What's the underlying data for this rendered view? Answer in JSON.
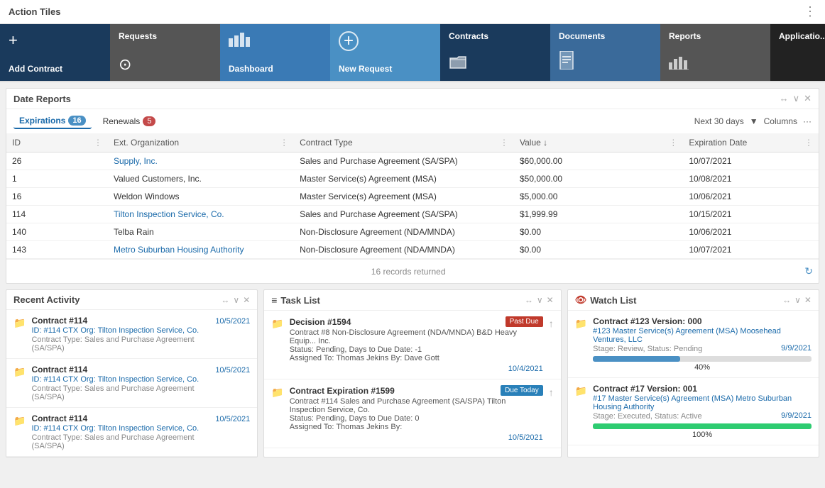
{
  "header": {
    "title": "Action Tiles",
    "menu_icon": "⋮"
  },
  "tiles": [
    {
      "id": "add-contract",
      "label": "Add Contract",
      "icon": "+",
      "style": "tile-blue-dark"
    },
    {
      "id": "requests",
      "label": "Requests",
      "icon": "⊙",
      "style": "tile-gray"
    },
    {
      "id": "dashboard",
      "label": "Dashboard",
      "icon": "📊",
      "style": "tile-blue-mid"
    },
    {
      "id": "new-request",
      "label": "New Request",
      "icon": "+",
      "style": "tile-blue-light"
    },
    {
      "id": "contracts",
      "label": "Contracts",
      "icon": "📁",
      "style": "tile-navy"
    },
    {
      "id": "documents",
      "label": "Documents",
      "icon": "📄",
      "style": "tile-steel"
    },
    {
      "id": "reports",
      "label": "Reports",
      "icon": "📊",
      "style": "tile-dark"
    },
    {
      "id": "applications",
      "label": "Applicatio...",
      "icon": "⬛",
      "style": "tile-black"
    }
  ],
  "date_reports": {
    "section_title": "Date Reports",
    "tabs": [
      {
        "label": "Expirations",
        "badge": "16",
        "active": true
      },
      {
        "label": "Renewals",
        "badge": "5",
        "active": false
      }
    ],
    "filter_label": "Next 30 days",
    "columns_label": "Columns",
    "table_headers": [
      "ID",
      "Ext. Organization",
      "Contract Type",
      "Value ↓",
      "Expiration Date"
    ],
    "table_rows": [
      {
        "id": "26",
        "org": "Supply, Inc.",
        "org_link": true,
        "type": "Sales and Purchase Agreement (SA/SPA)",
        "value": "$60,000.00",
        "expiration": "10/07/2021"
      },
      {
        "id": "1",
        "org": "Valued Customers, Inc.",
        "org_link": false,
        "type": "Master Service(s) Agreement (MSA)",
        "value": "$50,000.00",
        "expiration": "10/08/2021"
      },
      {
        "id": "16",
        "org": "Weldon Windows",
        "org_link": false,
        "type": "Master Service(s) Agreement (MSA)",
        "value": "$5,000.00",
        "expiration": "10/06/2021"
      },
      {
        "id": "114",
        "org": "Tilton Inspection Service, Co.",
        "org_link": true,
        "type": "Sales and Purchase Agreement (SA/SPA)",
        "value": "$1,999.99",
        "expiration": "10/15/2021"
      },
      {
        "id": "140",
        "org": "Telba Rain",
        "org_link": false,
        "type": "Non-Disclosure Agreement (NDA/MNDA)",
        "value": "$0.00",
        "expiration": "10/06/2021"
      },
      {
        "id": "143",
        "org": "Metro Suburban Housing Authority",
        "org_link": true,
        "type": "Non-Disclosure Agreement (NDA/MNDA)",
        "value": "$0.00",
        "expiration": "10/07/2021"
      }
    ],
    "footer_text": "16 records returned"
  },
  "recent_activity": {
    "title": "Recent Activity",
    "items": [
      {
        "title": "Contract #114",
        "detail1": "ID: #114  CTX Org: Tilton Inspection Service, Co.",
        "detail2": "Contract Type: Sales and Purchase Agreement (SA/SPA)",
        "date": "10/5/2021"
      },
      {
        "title": "Contract #114",
        "detail1": "ID: #114  CTX Org: Tilton Inspection Service, Co.",
        "detail2": "Contract Type: Sales and Purchase Agreement (SA/SPA)",
        "date": "10/5/2021"
      },
      {
        "title": "Contract #114",
        "detail1": "ID: #114  CTX Org: Tilton Inspection Service, Co.",
        "detail2": "Contract Type: Sales and Purchase Agreement (SA/SPA)",
        "date": "10/5/2021"
      }
    ]
  },
  "task_list": {
    "title": "Task List",
    "items": [
      {
        "id": "task-1594",
        "title": "Decision #1594",
        "badge": "Past Due",
        "badge_type": "red",
        "detail": "Contract #8 Non-Disclosure Agreement (NDA/MNDA) B&D Heavy Equip... Inc.",
        "status": "Status: Pending, Days to Due Date: -1",
        "assigned": "Assigned To: Thomas Jekins  By: Dave Gott",
        "date": "10/4/2021"
      },
      {
        "id": "task-1599",
        "title": "Contract Expiration #1599",
        "badge": "Due Today",
        "badge_type": "blue",
        "detail": "Contract #114 Sales and Purchase Agreement (SA/SPA) Tilton Inspection Service, Co.",
        "status": "Status: Pending, Days to Due Date: 0",
        "assigned": "Assigned To: Thomas Jekins  By:",
        "date": "10/5/2021"
      }
    ]
  },
  "watch_list": {
    "title": "Watch List",
    "items": [
      {
        "title": "Contract #123  Version: 000",
        "detail": "#123 Master Service(s) Agreement (MSA) Moosehead Ventures, LLC",
        "stage": "Stage: Review, Status: Pending",
        "date": "9/9/2021",
        "progress": 40,
        "progress_type": "blue"
      },
      {
        "title": "Contract #17  Version: 001",
        "detail": "#17 Master Service(s) Agreement (MSA) Metro Suburban Housing Authority",
        "stage": "Stage: Executed, Status: Active",
        "date": "9/9/2021",
        "progress": 100,
        "progress_type": "green"
      }
    ]
  },
  "icons": {
    "folder": "📁",
    "task": "☰",
    "eye": "👁",
    "dots": "⋮",
    "refresh": "↻",
    "collapse": "←→",
    "chevron": "∨",
    "close": "✕",
    "plus_circle": "⊕",
    "arrow_up": "↑",
    "arrow_right": "→"
  }
}
